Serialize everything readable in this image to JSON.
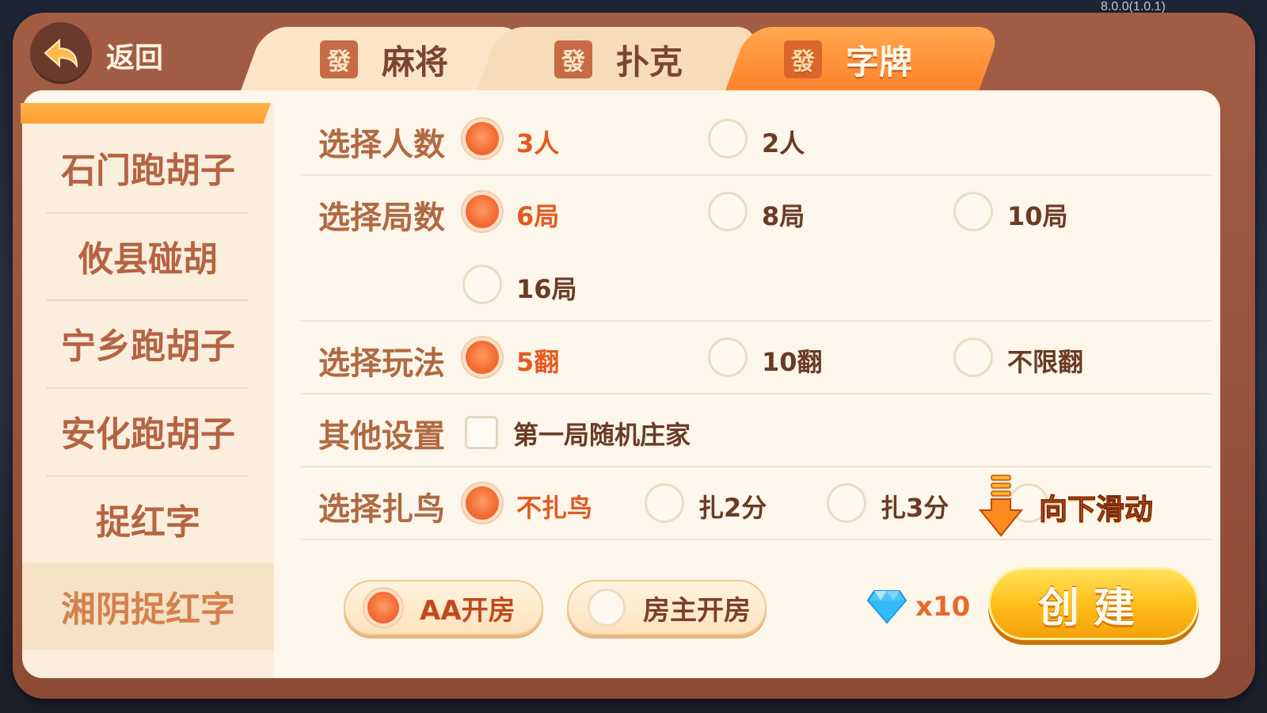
{
  "version": "8.0.0(1.0.1)",
  "header": {
    "back_label": "返回",
    "tabs": [
      {
        "icon_char": "發",
        "label": "麻将",
        "active": false
      },
      {
        "icon_char": "發",
        "label": "扑克",
        "active": false
      },
      {
        "icon_char": "發",
        "label": "字牌",
        "active": true
      }
    ]
  },
  "sidebar": {
    "items": [
      {
        "label": "石门跑胡子"
      },
      {
        "label": "攸县碰胡"
      },
      {
        "label": "宁乡跑胡子"
      },
      {
        "label": "安化跑胡子"
      },
      {
        "label": "捉红字"
      },
      {
        "label": "湘阴捉红字"
      }
    ]
  },
  "settings": {
    "players": {
      "label": "选择人数",
      "options": [
        "3人",
        "2人"
      ],
      "selected": "3人"
    },
    "rounds": {
      "label": "选择局数",
      "options": [
        "6局",
        "8局",
        "10局",
        "16局"
      ],
      "selected": "6局"
    },
    "mode": {
      "label": "选择玩法",
      "options": [
        "5翻",
        "10翻",
        "不限翻"
      ],
      "selected": "5翻"
    },
    "other": {
      "label": "其他设置",
      "checkbox_label": "第一局随机庄家",
      "checked": false
    },
    "zhaniao": {
      "label": "选择扎鸟",
      "options": [
        "不扎鸟",
        "扎2分",
        "扎3分"
      ],
      "selected": "不扎鸟"
    },
    "scroll_hint": "向下滑动"
  },
  "footer": {
    "pay_options": [
      "AA开房",
      "房主开房"
    ],
    "pay_selected": "AA开房",
    "diamond_cost": "x10",
    "create_label": "创建"
  },
  "colors": {
    "accent": "#f26b33",
    "frame": "#a35d45",
    "panel": "#fdf6ea",
    "create": "#ffbf1a"
  }
}
